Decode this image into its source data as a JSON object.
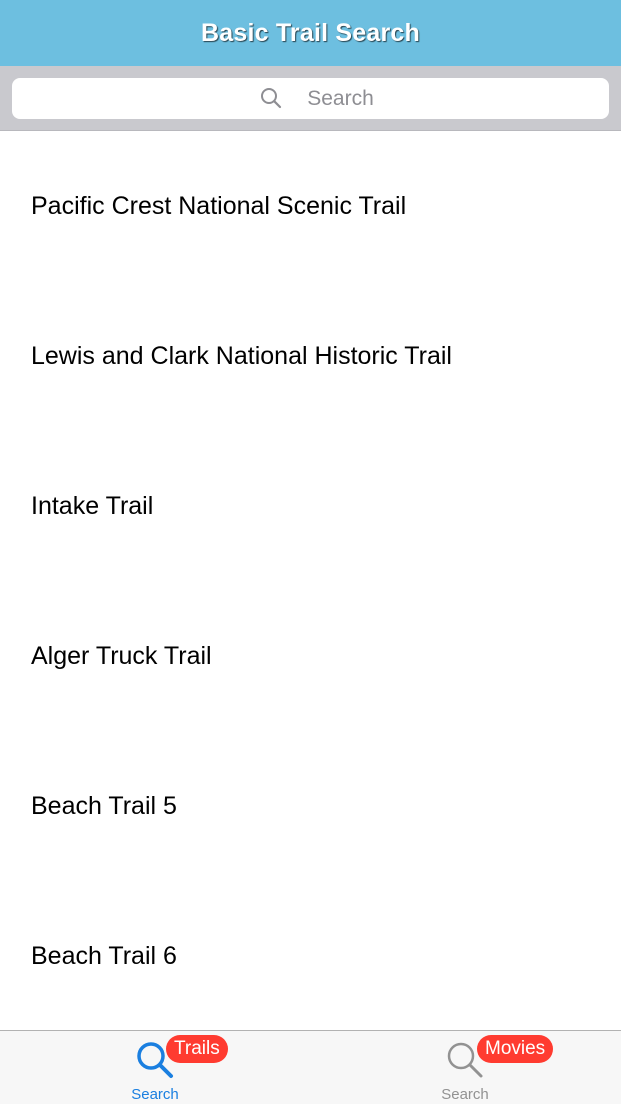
{
  "nav": {
    "title": "Basic Trail Search"
  },
  "search": {
    "placeholder": "Search",
    "value": ""
  },
  "trails": [
    "Pacific Crest National Scenic Trail",
    "Lewis and Clark National Historic Trail",
    "Intake Trail",
    "Alger Truck Trail",
    "Beach Trail 5",
    "Beach Trail 6"
  ],
  "tabs": [
    {
      "label": "Search",
      "badge": "Trails",
      "icon": "search-icon",
      "selected": true
    },
    {
      "label": "Search",
      "badge": "Movies",
      "icon": "search-icon",
      "selected": false
    }
  ],
  "colors": {
    "nav_background": "#6dbfe0",
    "tab_selected": "#1a7fe0",
    "tab_unselected": "#929292",
    "badge": "#ff3b30"
  }
}
